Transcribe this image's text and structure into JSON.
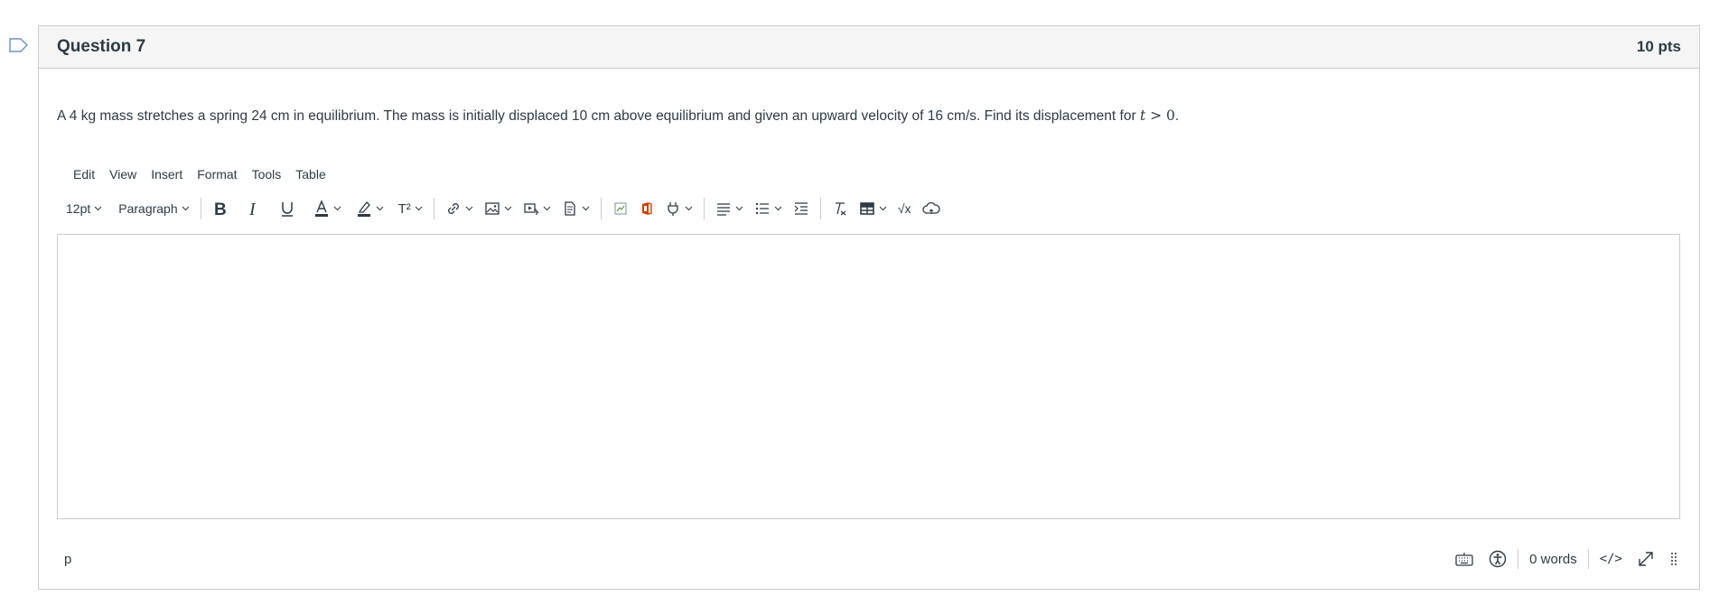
{
  "question": {
    "title": "Question 7",
    "points": "10 pts",
    "text_before_math": "A 4 kg mass stretches a spring 24 cm in equilibrium. The mass is initially displaced 10 cm above equilibrium and given an upward velocity of 16 cm/s. Find its displacement for ",
    "math_variable": "t",
    "math_rest": " > 0",
    "text_after_math": "."
  },
  "editor": {
    "menu": [
      "Edit",
      "View",
      "Insert",
      "Format",
      "Tools",
      "Table"
    ],
    "font_size": "12pt",
    "block_format": "Paragraph",
    "superscript_label": "T²",
    "equation_label": "√x",
    "icons": [
      "bold-icon",
      "italic-icon",
      "underline-icon",
      "text-color-icon",
      "highlight-icon",
      "superscript-icon",
      "link-icon",
      "image-icon",
      "media-icon",
      "document-icon",
      "broken-image-icon",
      "office-icon",
      "plugin-icon",
      "align-icon",
      "bullet-list-icon",
      "indent-icon",
      "clear-format-icon",
      "table-icon",
      "equation-icon",
      "cloud-icon"
    ],
    "content": "",
    "path": "p",
    "word_count": "0 words",
    "html_toggle": "</>"
  },
  "colors": {
    "text": "#2d3b45",
    "border": "#c7cdd1",
    "header_bg": "#f5f5f5",
    "office_red": "#d83b01",
    "flag": "#6d8fc7"
  }
}
